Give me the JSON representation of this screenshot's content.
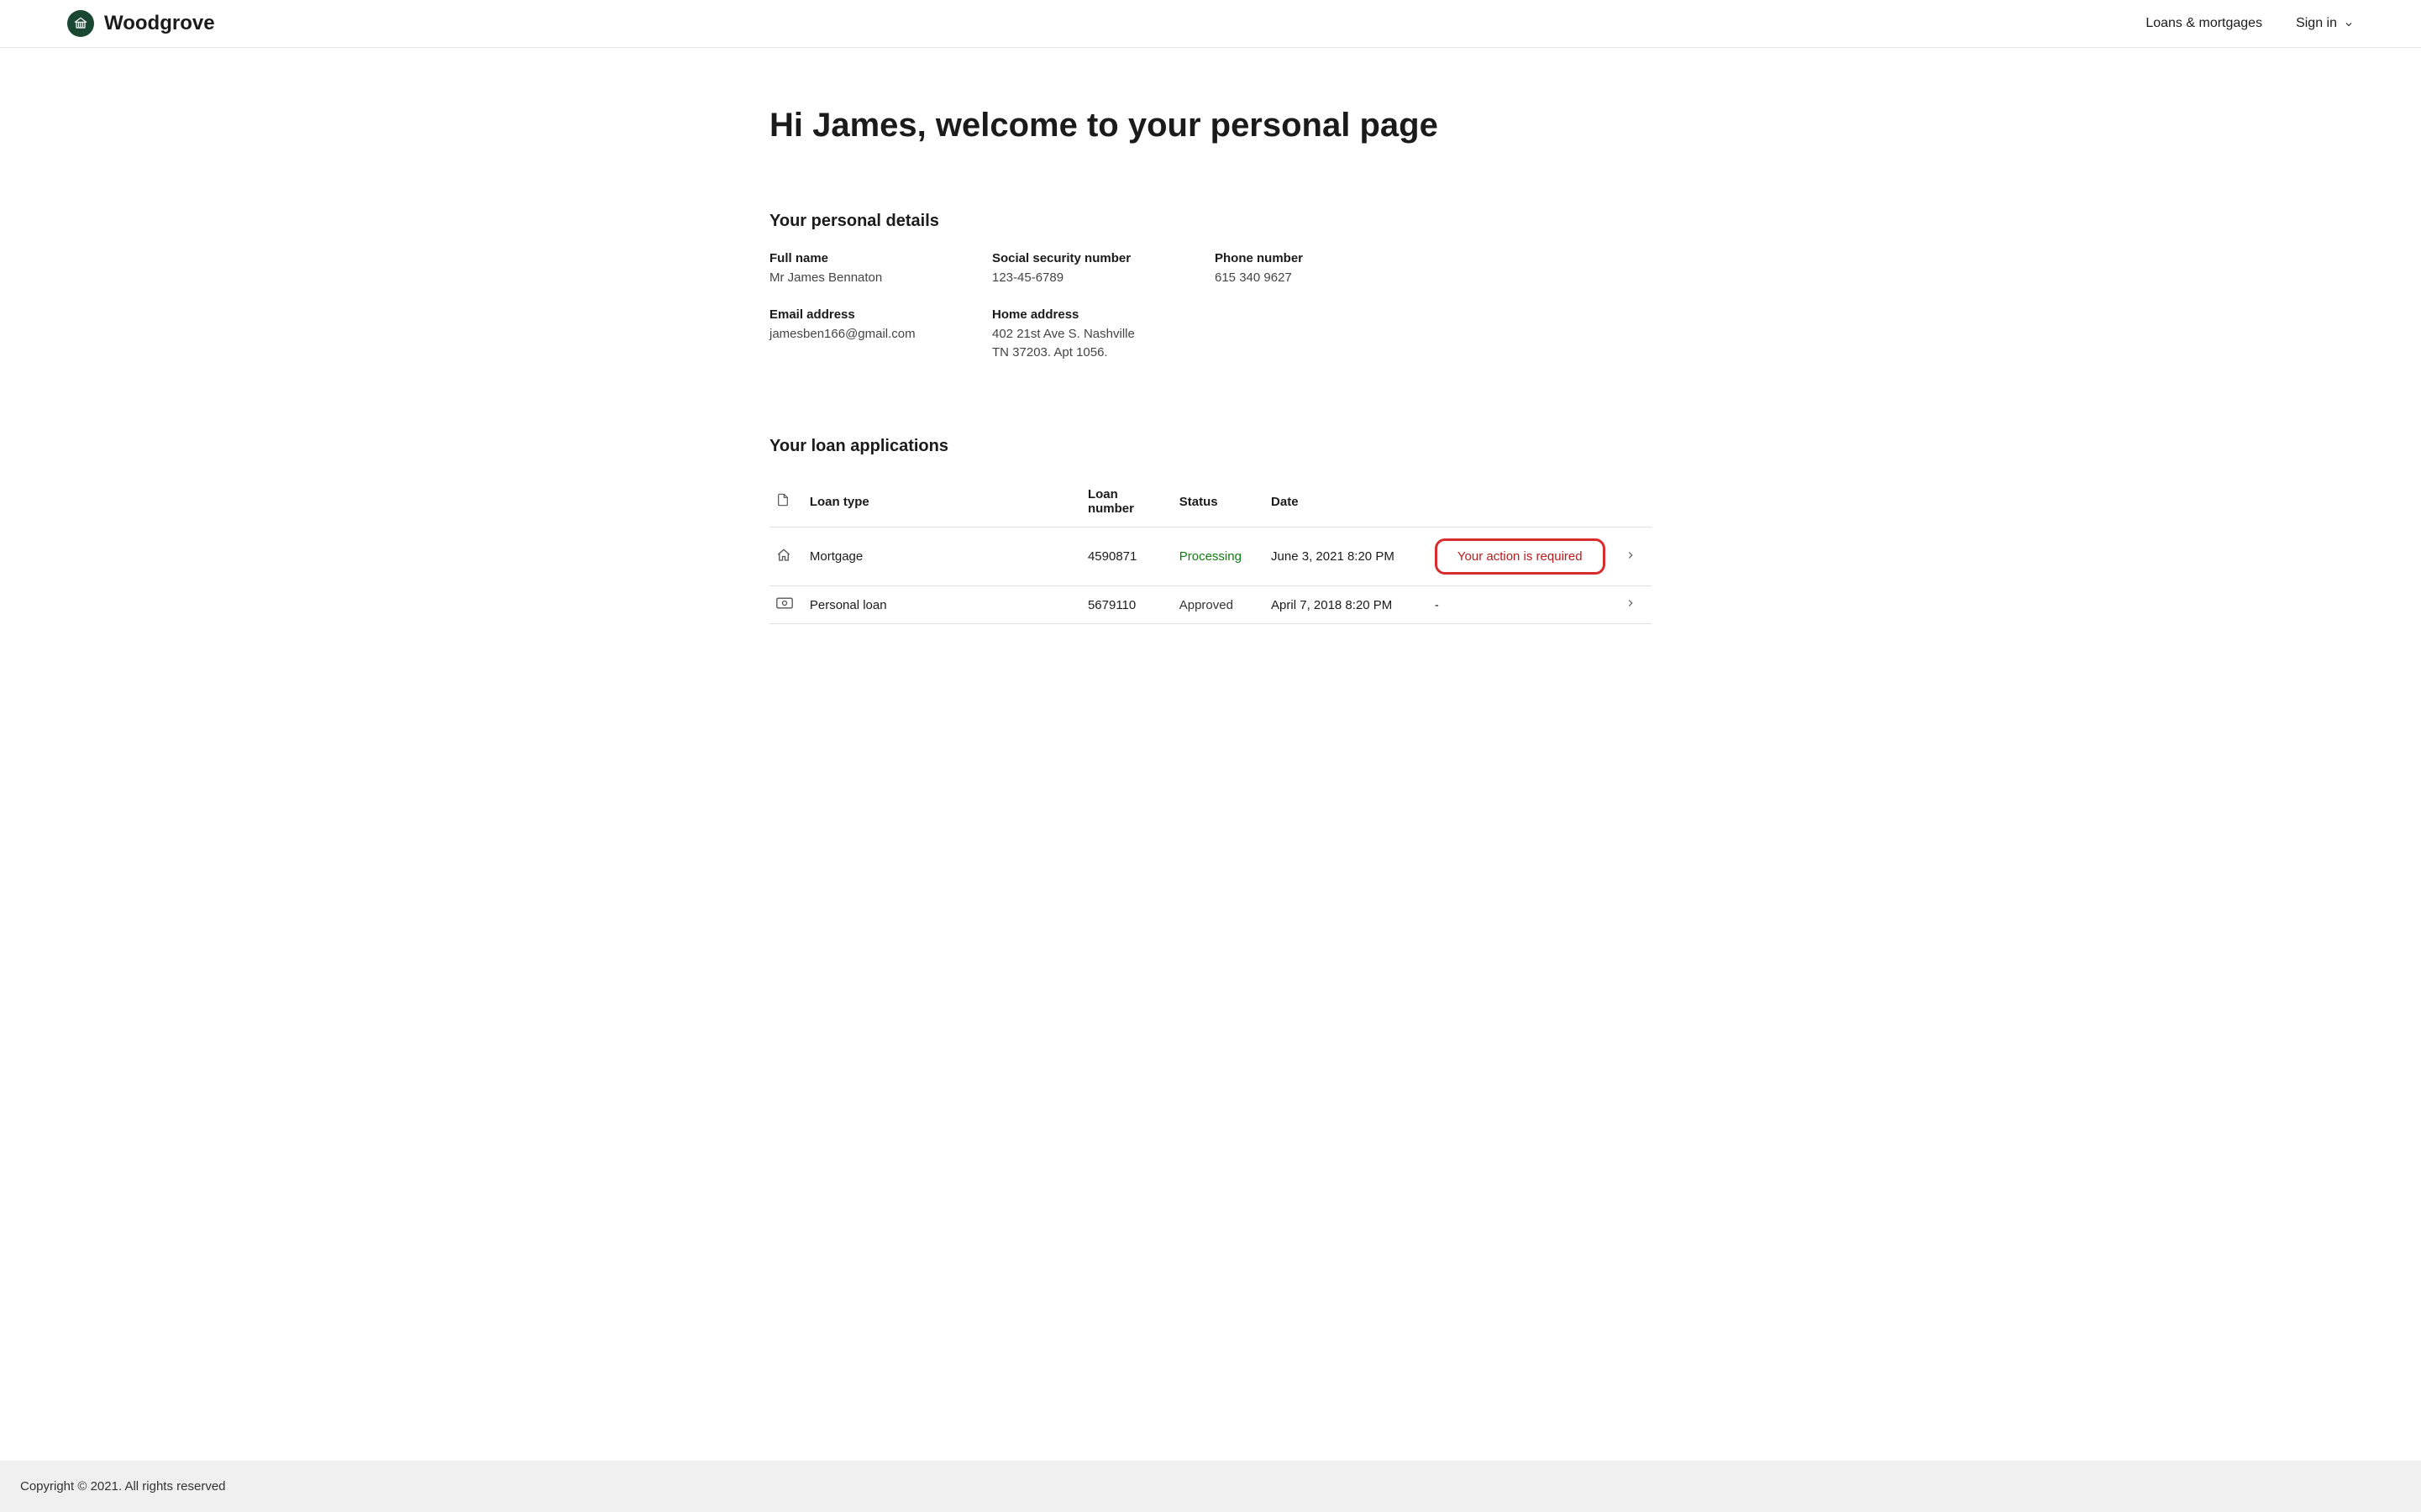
{
  "header": {
    "brand": "Woodgrove",
    "nav": {
      "loans": "Loans & mortgages",
      "signin": "Sign in"
    }
  },
  "page": {
    "title": "Hi James, welcome to your personal page"
  },
  "personal": {
    "section_title": "Your personal details",
    "items": [
      {
        "label": "Full name",
        "value": "Mr James Bennaton"
      },
      {
        "label": "Social security number",
        "value": "123-45-6789"
      },
      {
        "label": "Phone number",
        "value": "615 340 9627"
      },
      {
        "label": "Email address",
        "value": "jamesben166@gmail.com"
      },
      {
        "label": "Home address",
        "value": "402  21st Ave S. Nashville TN 37203. Apt 1056."
      }
    ]
  },
  "loans": {
    "section_title": "Your loan applications",
    "headers": {
      "type": "Loan type",
      "number": "Loan number",
      "status": "Status",
      "date": "Date"
    },
    "rows": [
      {
        "type": "Mortgage",
        "number": "4590871",
        "status": "Processing",
        "status_class": "processing",
        "date": "June 3, 2021 8:20 PM",
        "action": "Your action is required",
        "icon": "home"
      },
      {
        "type": "Personal loan",
        "number": "5679110",
        "status": "Approved",
        "status_class": "approved",
        "date": "April 7, 2018 8:20 PM",
        "action": "-",
        "icon": "money"
      }
    ]
  },
  "footer": {
    "copyright": "Copyright © 2021. All rights reserved"
  }
}
